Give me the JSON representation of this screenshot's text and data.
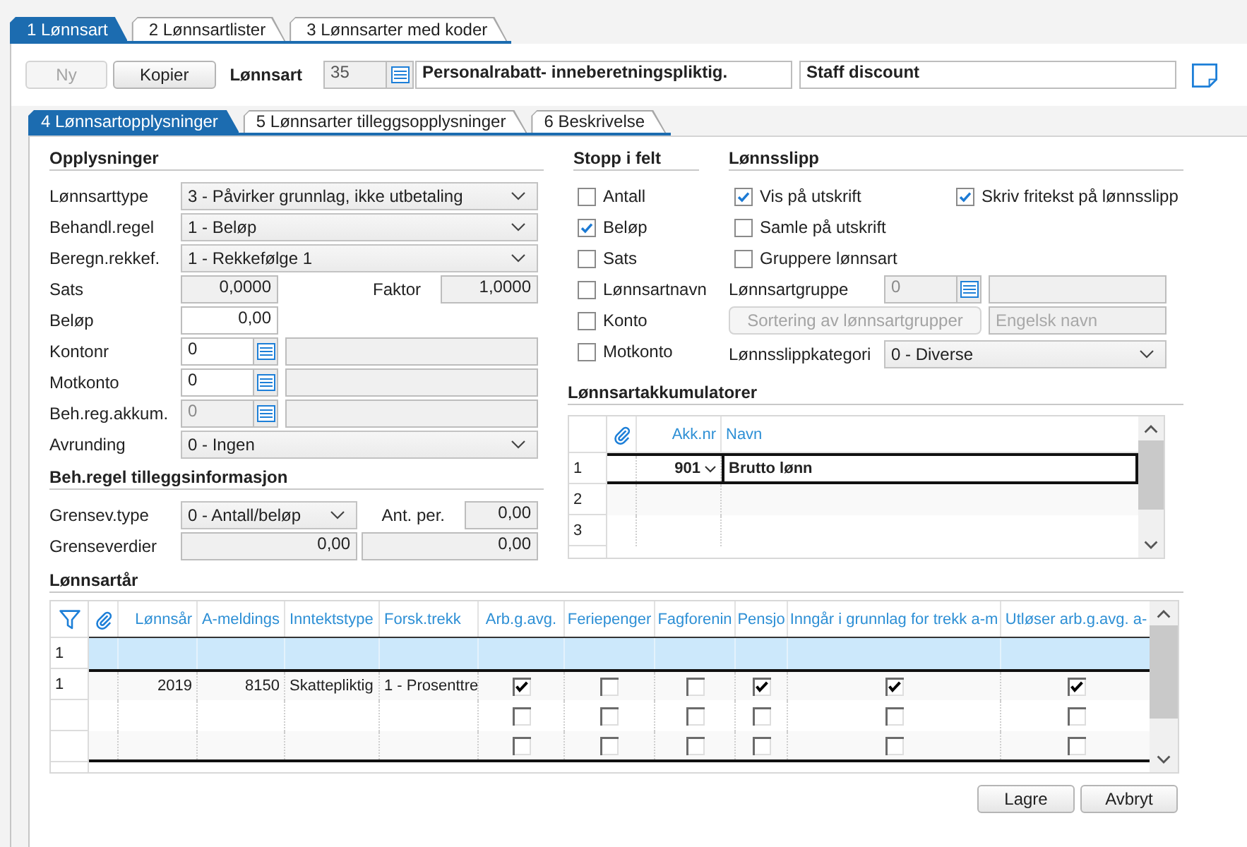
{
  "top_tabs": [
    {
      "label": "1 Lønnsart",
      "selected": true
    },
    {
      "label": "2 Lønnsartlister",
      "selected": false
    },
    {
      "label": "3 Lønnsarter med koder",
      "selected": false
    }
  ],
  "toolbar": {
    "buttons": [
      {
        "label": "Ny",
        "disabled": true
      },
      {
        "label": "Kopier",
        "disabled": false
      }
    ],
    "label": "Lønnsart",
    "number": "35",
    "name": "Personalrabatt- inneberetningspliktig.",
    "english_name": "Staff discount"
  },
  "sub_tabs": [
    {
      "label": "4 Lønnsartopplysninger",
      "selected": true
    },
    {
      "label": "5 Lønnsarter tilleggsopplysninger",
      "selected": false
    },
    {
      "label": "6 Beskrivelse",
      "selected": false
    }
  ],
  "info": {
    "title": "Opplysninger",
    "rows": [
      {
        "kind": "select",
        "label": "Lønnsarttype",
        "value": "3 - Påvirker grunnlag, ikke utbetaling"
      },
      {
        "kind": "select",
        "label": "Behandl.regel",
        "value": "1 - Beløp"
      },
      {
        "kind": "select",
        "label": "Beregn.rekkef.",
        "value": "1 - Rekkefølge 1"
      },
      {
        "kind": "number",
        "label": "Sats",
        "value": "0,0000",
        "disabled": true,
        "extra": {
          "label": "Faktor",
          "value": "1,0000",
          "disabled": true
        }
      },
      {
        "kind": "number",
        "label": "Beløp",
        "value": "0,00",
        "disabled": false
      },
      {
        "kind": "lookup",
        "label": "Kontonr",
        "value": "0",
        "disabled": false
      },
      {
        "kind": "lookup",
        "label": "Motkonto",
        "value": "0",
        "disabled": false
      },
      {
        "kind": "lookup",
        "label": "Beh.reg.akkum.",
        "value": "0",
        "disabled": true
      },
      {
        "kind": "select",
        "label": "Avrunding",
        "value": "0 - Ingen"
      }
    ]
  },
  "extra_info": {
    "title": "Beh.regel tilleggsinformasjon",
    "rows": [
      {
        "kind": "half_select",
        "label": "Grensev.type",
        "value": "0 - Antall/beløp",
        "extra": {
          "label": "Ant. per.",
          "value": "0,00",
          "disabled": true
        }
      },
      {
        "kind": "pair",
        "label": "Grenseverdier",
        "values": [
          "0,00",
          "0,00"
        ],
        "disabled": true
      }
    ]
  },
  "stop_fields": {
    "title": "Stopp i felt",
    "items": [
      {
        "label": "Antall",
        "checked": false
      },
      {
        "label": "Beløp",
        "checked": true
      },
      {
        "label": "Sats",
        "checked": false
      },
      {
        "label": "Lønnsartnavn",
        "checked": false
      },
      {
        "label": "Konto",
        "checked": false
      },
      {
        "label": "Motkonto",
        "checked": false
      }
    ]
  },
  "payslip": {
    "title": "Lønnsslipp",
    "checkbox_rows": [
      [
        {
          "label": "Vis på utskrift",
          "checked": true
        },
        {
          "label": "Skriv fritekst på lønnsslipp",
          "checked": true
        }
      ],
      [
        {
          "label": "Samle på utskrift",
          "checked": false
        }
      ],
      [
        {
          "label": "Gruppere lønnsart",
          "checked": false
        }
      ]
    ],
    "group": {
      "label": "Lønnsartgruppe",
      "value": "0",
      "disabled": true
    },
    "sort_button": {
      "label": "Sortering av lønnsartgrupper",
      "disabled": true
    },
    "english_name": {
      "placeholder": "Engelsk navn",
      "disabled": true
    },
    "category": {
      "label": "Lønnsslippkategori",
      "value": "0 - Diverse"
    }
  },
  "accumulators": {
    "title": "Lønnsartakkumulatorer",
    "columns": [
      "Akk.nr",
      "Navn"
    ],
    "rows": [
      {
        "number": "1",
        "akk_nr": "901",
        "name": "Brutto lønn",
        "selected": true
      },
      {
        "number": "2",
        "selected": false
      },
      {
        "number": "3",
        "selected": false
      }
    ]
  },
  "years": {
    "title": "Lønnsartår",
    "columns": [
      {
        "label": "Lønnsår",
        "kind": "number"
      },
      {
        "label": "A-meldings",
        "kind": "number"
      },
      {
        "label": "Inntektstype",
        "kind": "text"
      },
      {
        "label": "Forsk.trekk",
        "kind": "text"
      },
      {
        "label": "Arb.g.avg.",
        "kind": "check"
      },
      {
        "label": "Feriepenger",
        "kind": "check"
      },
      {
        "label": "Fagforenin",
        "kind": "check"
      },
      {
        "label": "Pensjo",
        "kind": "check"
      },
      {
        "label": "Inngår i grunnlag for trekk a-m",
        "kind": "check"
      },
      {
        "label": "Utløser arb.g.avg. a-",
        "kind": "check"
      }
    ],
    "filter_row": {
      "number": "1"
    },
    "rows": [
      {
        "number": "1",
        "values": [
          "2019",
          "8150",
          "Skattepliktig",
          "1 - Prosenttre"
        ],
        "checks": [
          true,
          false,
          false,
          true,
          true,
          true
        ]
      },
      {
        "checks": [
          false,
          false,
          false,
          false,
          false,
          false
        ]
      },
      {
        "checks": [
          false,
          false,
          false,
          false,
          false,
          false
        ]
      }
    ]
  },
  "buttons": [
    {
      "label": "Lagre"
    },
    {
      "label": "Avbryt"
    }
  ]
}
